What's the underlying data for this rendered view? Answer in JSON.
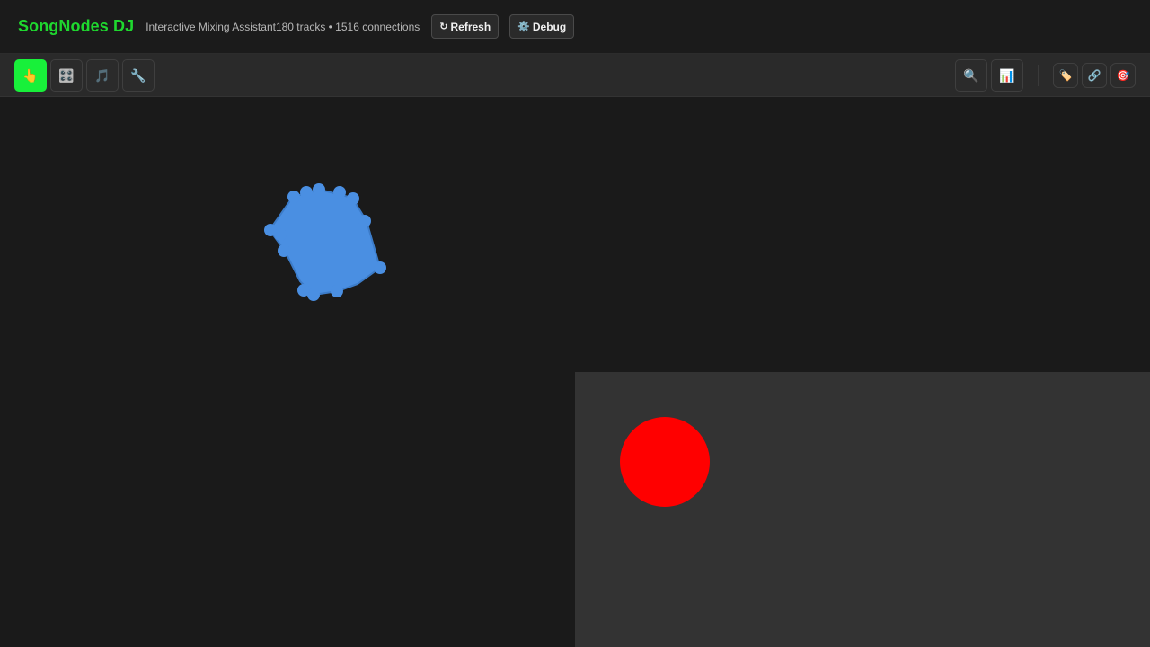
{
  "header": {
    "brand": "SongNodes DJ",
    "subtitle": "Interactive Mixing Assistant",
    "stats": "180 tracks • 1516 connections",
    "refresh_icon": "↻",
    "refresh_label": "Refresh",
    "debug_icon": "⚙️",
    "debug_label": "Debug"
  },
  "toolbar": {
    "modes": [
      {
        "icon": "👆",
        "name": "select-mode"
      },
      {
        "icon": "🎛️",
        "name": "mix-mode"
      },
      {
        "icon": "🎵",
        "name": "music-mode"
      },
      {
        "icon": "🔧",
        "name": "tools-mode"
      }
    ],
    "search_icon": "🔍",
    "stats_icon": "📊",
    "labels_icon": "🏷️",
    "link_icon": "🔗",
    "target_icon": "🎯"
  },
  "graph": {
    "node_color": "#4a8fe2",
    "highlight_color": "#ff0000"
  },
  "colors": {
    "brand": "#1fd82f",
    "active_mode": "#18f03a",
    "panel": "#333333"
  }
}
